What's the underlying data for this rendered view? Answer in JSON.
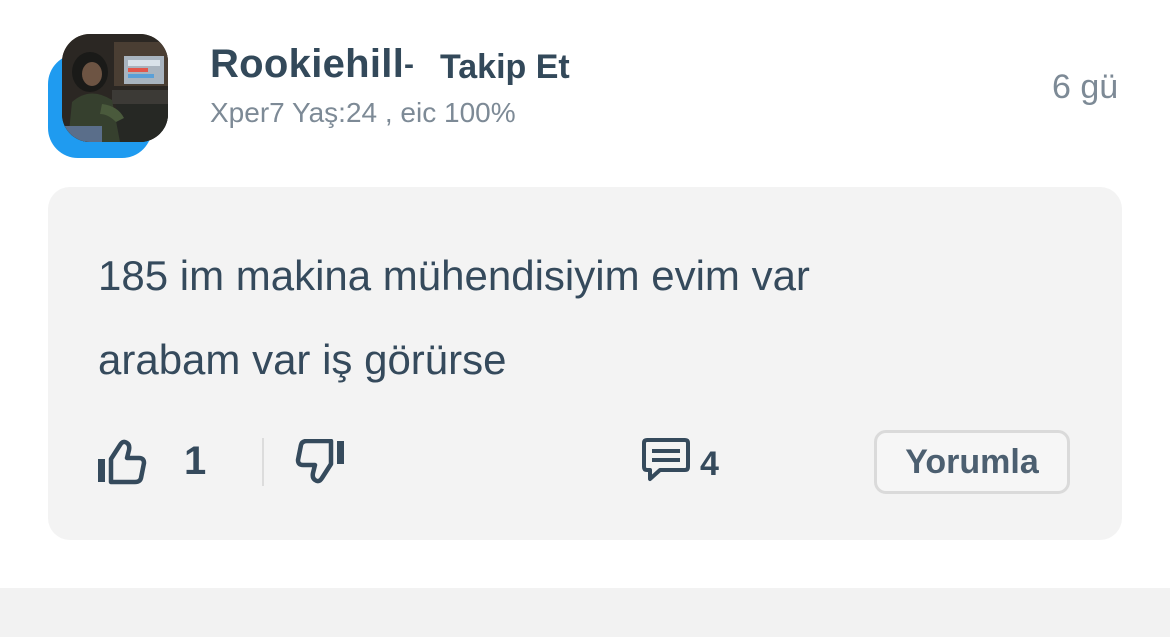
{
  "post": {
    "author": {
      "username": "Rookiehill",
      "separator": "-",
      "follow_label": "Takip Et",
      "meta": "Xper7 Yaş:24 , eic 100%"
    },
    "timestamp": "6 gü",
    "body_line1": "185 im makina mühendisiyim evim var",
    "body_line2": "arabam var iş görürse",
    "actions": {
      "like_count": "1",
      "comment_count": "4",
      "reply_label": "Yorumla"
    }
  },
  "icons": {
    "like": "thumbs-up-icon",
    "dislike": "thumbs-down-icon",
    "comment": "comment-icon"
  },
  "colors": {
    "accent": "#1f9bf0",
    "text": "#354a5c",
    "muted": "#7d8a96",
    "card_bg": "#f3f3f3"
  }
}
